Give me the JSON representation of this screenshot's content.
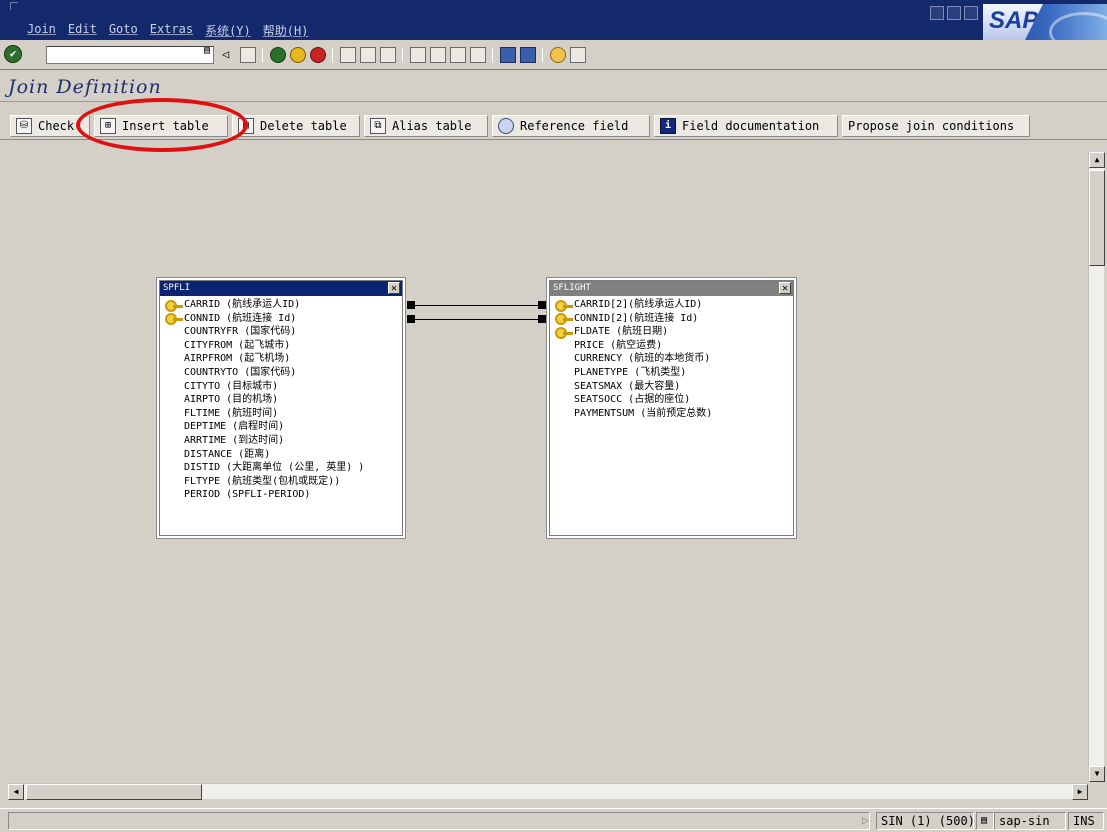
{
  "menu": {
    "items": [
      "Join",
      "Edit",
      "Goto",
      "Extras",
      "系统(Y)",
      "帮助(H)"
    ]
  },
  "logo": "SAP",
  "page": {
    "title": "Join Definition"
  },
  "app_toolbar": {
    "check": "Check",
    "insert_table": "Insert table",
    "delete_table": "Delete table",
    "alias_table": "Alias table",
    "reference_field": "Reference field",
    "field_documentation": "Field documentation",
    "propose_join_conditions": "Propose join conditions"
  },
  "tables": [
    {
      "name": "SPFLI",
      "header_color": "#0a2472",
      "fields": [
        {
          "text": "CARRID (航线承运人ID)",
          "key": true
        },
        {
          "text": "CONNID (航班连接 Id)",
          "key": true
        },
        {
          "text": "COUNTRYFR (国家代码)",
          "key": false
        },
        {
          "text": "CITYFROM (起飞城市)",
          "key": false
        },
        {
          "text": "AIRPFROM (起飞机场)",
          "key": false
        },
        {
          "text": "COUNTRYTO (国家代码)",
          "key": false
        },
        {
          "text": "CITYTO (目标城市)",
          "key": false
        },
        {
          "text": "AIRPTO (目的机场)",
          "key": false
        },
        {
          "text": "FLTIME (航班时间)",
          "key": false
        },
        {
          "text": "DEPTIME (启程时间)",
          "key": false
        },
        {
          "text": "ARRTIME (到达时间)",
          "key": false
        },
        {
          "text": "DISTANCE (距离)",
          "key": false
        },
        {
          "text": "DISTID (大距离单位 (公里, 英里) )",
          "key": false
        },
        {
          "text": "FLTYPE (航班类型(包机或既定))",
          "key": false
        },
        {
          "text": "PERIOD (SPFLI-PERIOD)",
          "key": false
        }
      ]
    },
    {
      "name": "SFLIGHT",
      "header_color": "#808080",
      "fields": [
        {
          "text": "CARRID[2](航线承运人ID)",
          "key": true
        },
        {
          "text": "CONNID[2](航班连接 Id)",
          "key": true
        },
        {
          "text": "FLDATE (航班日期)",
          "key": true
        },
        {
          "text": "PRICE (航空运费)",
          "key": false
        },
        {
          "text": "CURRENCY (航班的本地货币)",
          "key": false
        },
        {
          "text": "PLANETYPE (飞机类型)",
          "key": false
        },
        {
          "text": "SEATSMAX (最大容量)",
          "key": false
        },
        {
          "text": "SEATSOCC (占据的座位)",
          "key": false
        },
        {
          "text": "PAYMENTSUM (当前预定总数)",
          "key": false
        }
      ]
    }
  ],
  "status": {
    "system": "SIN (1) (500)",
    "server": "sap-sin",
    "mode": "INS"
  },
  "colors": {
    "highlight": "#e01010",
    "title": "#1e2f6b",
    "menubar": "#14296b"
  }
}
